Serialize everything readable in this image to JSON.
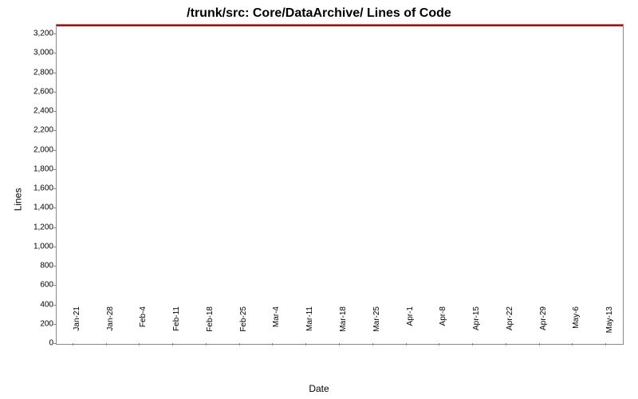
{
  "chart_data": {
    "type": "line",
    "title": "/trunk/src: Core/DataArchive/ Lines of Code",
    "xlabel": "Date",
    "ylabel": "Lines",
    "ylim": [
      0,
      3300
    ],
    "y_ticks": [
      0,
      200,
      400,
      600,
      800,
      1000,
      1200,
      1400,
      1600,
      1800,
      2000,
      2200,
      2400,
      2600,
      2800,
      3000,
      3200
    ],
    "x_ticks": [
      "21-Jan",
      "28-Jan",
      "4-Feb",
      "11-Feb",
      "18-Feb",
      "25-Feb",
      "4-Mar",
      "11-Mar",
      "18-Mar",
      "25-Mar",
      "1-Apr",
      "8-Apr",
      "15-Apr",
      "22-Apr",
      "29-Apr",
      "6-May",
      "13-May"
    ],
    "categories": [
      "21-Jan",
      "28-Jan",
      "4-Feb",
      "11-Feb",
      "18-Feb",
      "25-Feb",
      "4-Mar",
      "11-Mar",
      "18-Mar",
      "25-Mar",
      "1-Apr",
      "8-Apr",
      "15-Apr",
      "22-Apr",
      "29-Apr",
      "6-May",
      "13-May"
    ],
    "values": [
      3300,
      3300,
      3300,
      3300,
      3300,
      3300,
      3300,
      3300,
      3300,
      3300,
      3300,
      3300,
      3300,
      3300,
      3300,
      3300,
      3300
    ]
  }
}
